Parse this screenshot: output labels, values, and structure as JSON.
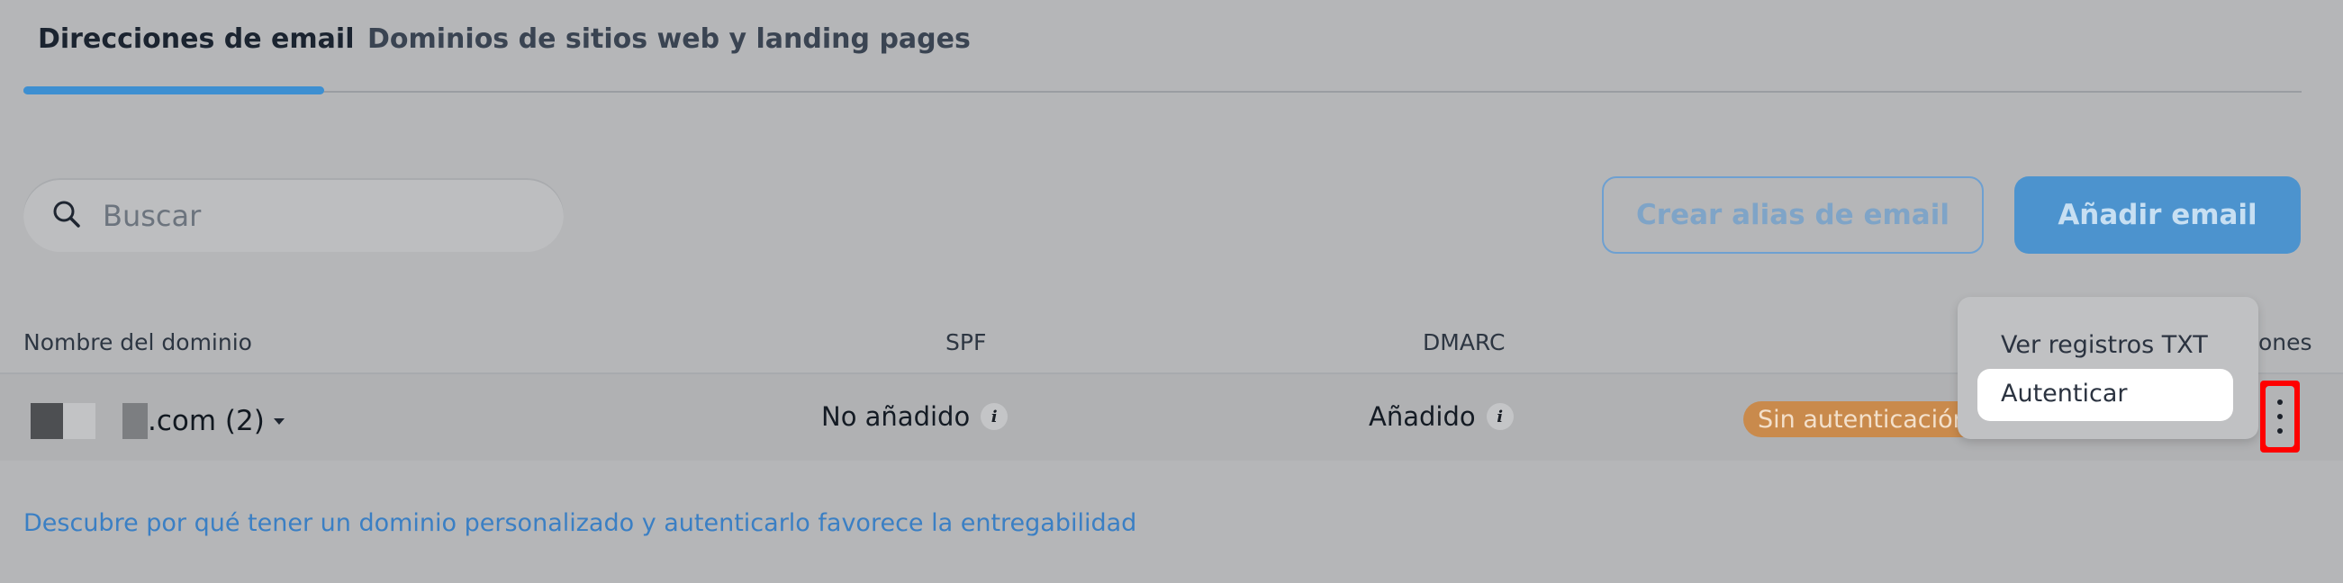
{
  "tabs": [
    {
      "label": "Direcciones de email",
      "active": true
    },
    {
      "label": "Dominios de sitios web y landing pages",
      "active": false
    }
  ],
  "search": {
    "placeholder": "Buscar",
    "icon": "search-icon"
  },
  "buttons": {
    "alias": "Crear alias de email",
    "add": "Añadir email"
  },
  "table": {
    "headers": {
      "domain": "Nombre del dominio",
      "spf": "SPF",
      "dmarc": "DMARC",
      "actions_partial": "ones"
    },
    "rows": [
      {
        "domain": ".com (2)",
        "spf": "No añadido",
        "dmarc": "Añadido",
        "status": "Sin autenticación"
      }
    ]
  },
  "dropdown": {
    "items": [
      "Ver registros TXT",
      "Autenticar"
    ],
    "highlighted_index": 1
  },
  "footer_link": "Descubre por qué tener un dominio personalizado y autenticarlo favorece la entregabilidad",
  "colors": {
    "accent": "#3d8fd1",
    "status_badge": "#c98a4c",
    "highlight_border": "#ff0000",
    "link": "#3a7fc4"
  }
}
